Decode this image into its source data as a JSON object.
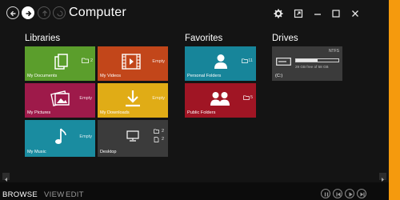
{
  "window": {
    "title": "Computer"
  },
  "sections": {
    "libraries": "Libraries",
    "favorites": "Favorites",
    "drives": "Drives"
  },
  "libraries": [
    {
      "label": "My Documents",
      "count": "2",
      "color": "#5b9e2c",
      "icon": "documents-icon"
    },
    {
      "label": "My Videos",
      "count": "Empty",
      "color": "#c2461a",
      "icon": "film-icon"
    },
    {
      "label": "My Pictures",
      "count": "Empty",
      "color": "#9e1a4a",
      "icon": "pictures-icon"
    },
    {
      "label": "My Downloads",
      "count": "Empty",
      "color": "#e0ac16",
      "icon": "download-icon"
    },
    {
      "label": "My Music",
      "count": "Empty",
      "color": "#1a8ca0",
      "icon": "music-note-icon"
    },
    {
      "label": "Desktop",
      "count_folders": "2",
      "count_files": "2",
      "color": "#3b3b3b",
      "icon": "desktop-icon"
    }
  ],
  "favorites": [
    {
      "label": "Personal Folders",
      "count": "11",
      "color": "#17859a",
      "icon": "person-icon"
    },
    {
      "label": "Public Folders",
      "count": "5",
      "color": "#a01524",
      "icon": "people-icon"
    }
  ],
  "drive": {
    "filesystem": "NTFS",
    "free_text": "29 GB free of 58 GB",
    "letter": "(C:)",
    "used_fraction": 0.5
  },
  "modes": {
    "browse": "BROWSE",
    "view": "VIEW",
    "edit": "EDIT"
  },
  "colors": {
    "accent": "#f59a0d",
    "background": "#141414"
  }
}
